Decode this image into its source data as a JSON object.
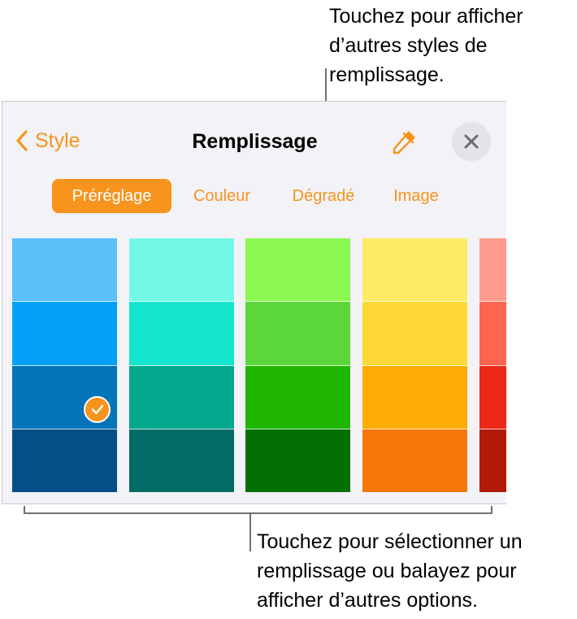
{
  "callouts": {
    "top": "Touchez pour afficher\nd’autres styles de\nremplissage.",
    "bottom": "Touchez pour sélectionner un\nremplissage ou balayez pour\nafficher d’autres options."
  },
  "panel": {
    "back_label": "Style",
    "title": "Remplissage",
    "back_icon": "chevron-left-icon",
    "eyedropper_icon": "eyedropper-icon",
    "close_icon": "close-icon"
  },
  "tabs": [
    {
      "label": "Préréglage",
      "active": true
    },
    {
      "label": "Couleur",
      "active": false
    },
    {
      "label": "Dégradé",
      "active": false
    },
    {
      "label": "Image",
      "active": false
    }
  ],
  "colors": {
    "accent": "#f7941d",
    "panel_bg": "#f2f2f7"
  },
  "swatches": [
    {
      "name": "blue",
      "shades": [
        "#5ac1fb",
        "#04a1f8",
        "#0475b8",
        "#034f86"
      ]
    },
    {
      "name": "teal",
      "shades": [
        "#72f9e6",
        "#14e5cd",
        "#01a88b",
        "#016c65"
      ]
    },
    {
      "name": "green",
      "shades": [
        "#8bf951",
        "#5cd73a",
        "#1fb700",
        "#027002"
      ]
    },
    {
      "name": "yellow",
      "shades": [
        "#fdeb63",
        "#fed834",
        "#fdac05",
        "#f47707"
      ]
    },
    {
      "name": "red",
      "shades": [
        "#fe9a8d",
        "#fe6550",
        "#ec2818",
        "#b11a07"
      ]
    }
  ],
  "selected": {
    "column": 0,
    "shade": 2
  }
}
